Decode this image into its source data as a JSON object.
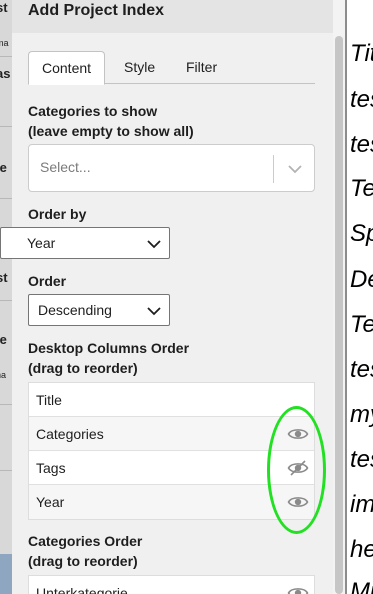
{
  "panel": {
    "title": "Add Project Index",
    "tabs": [
      {
        "label": "Content",
        "active": true
      },
      {
        "label": "Style",
        "active": false
      },
      {
        "label": "Filter",
        "active": false
      }
    ]
  },
  "categories": {
    "label_line1": "Categories to show",
    "label_line2": "(leave empty to show all)",
    "placeholder": "Select..."
  },
  "order_by": {
    "label": "Order by",
    "value": "Year"
  },
  "order": {
    "label": "Order",
    "value": "Descending"
  },
  "desktop_columns": {
    "label_line1": "Desktop Columns Order",
    "label_line2": "(drag to reorder)",
    "items": [
      {
        "label": "Title",
        "eye": "none"
      },
      {
        "label": "Categories",
        "eye": "visible"
      },
      {
        "label": "Tags",
        "eye": "hidden"
      },
      {
        "label": "Year",
        "eye": "visible"
      }
    ]
  },
  "categories_order": {
    "label_line1": "Categories Order",
    "label_line2": "(drag to reorder)",
    "items": [
      {
        "label": "Unterkategorie",
        "eye": "visible"
      }
    ]
  },
  "background_right_items": [
    "Tit",
    "tes",
    "tes",
    "Te",
    "Sp",
    "De",
    "Te",
    "tes",
    "my",
    "tes",
    "im",
    "he",
    "Mu"
  ],
  "background_left_fragments": [
    "st",
    "ma",
    "as",
    "je",
    "st",
    "ie",
    "na"
  ],
  "colors": {
    "annotation": "#22e022",
    "panel_bg": "#f0f0f0"
  }
}
